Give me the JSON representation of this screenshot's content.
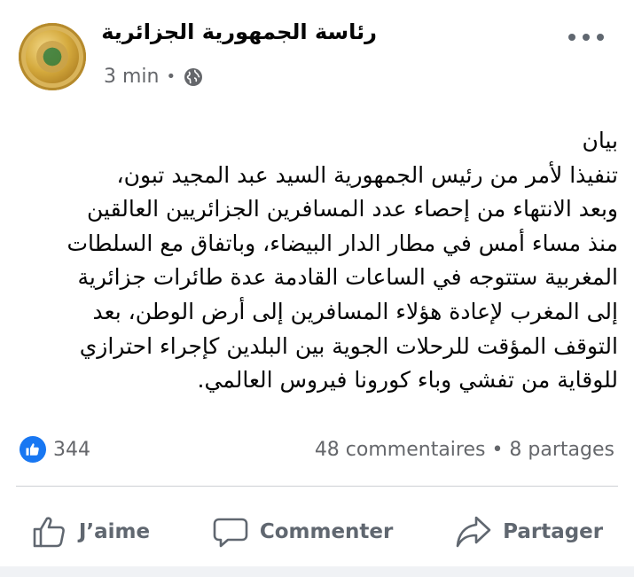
{
  "post": {
    "page_name": "رئاسة الجمهورية الجزائرية",
    "time": "3 min",
    "separator": "•",
    "privacy_icon": "globe-icon",
    "more_icon": "more-options-icon",
    "lines": [
      "بيان",
      "تنفيذا لأمر من رئيس الجمهورية السيد عبد المجيد تبون،",
      "وبعد الانتهاء من إحصاء عدد المسافرين الجزائريين العالقين",
      "منذ مساء أمس في مطار الدار البيضاء، وباتفاق مع السلطات",
      "المغربية ستتوجه في الساعات القادمة عدة طائرات جزائرية",
      "إلى المغرب لإعادة هؤلاء المسافرين إلى أرض الوطن، بعد",
      "التوقف المؤقت للرحلات الجوية بين البلدين كإجراء احترازي",
      "للوقاية من تفشي وباء كورونا فيروس العالمي."
    ]
  },
  "reactions": {
    "icon": "like-icon",
    "count": "344",
    "summary": "48 commentaires • 8 partages"
  },
  "actions": {
    "like_label": "J’aime",
    "comment_label": "Commenter",
    "share_label": "Partager"
  },
  "colors": {
    "accent": "#1877f2",
    "secondary_text": "#65676b"
  }
}
